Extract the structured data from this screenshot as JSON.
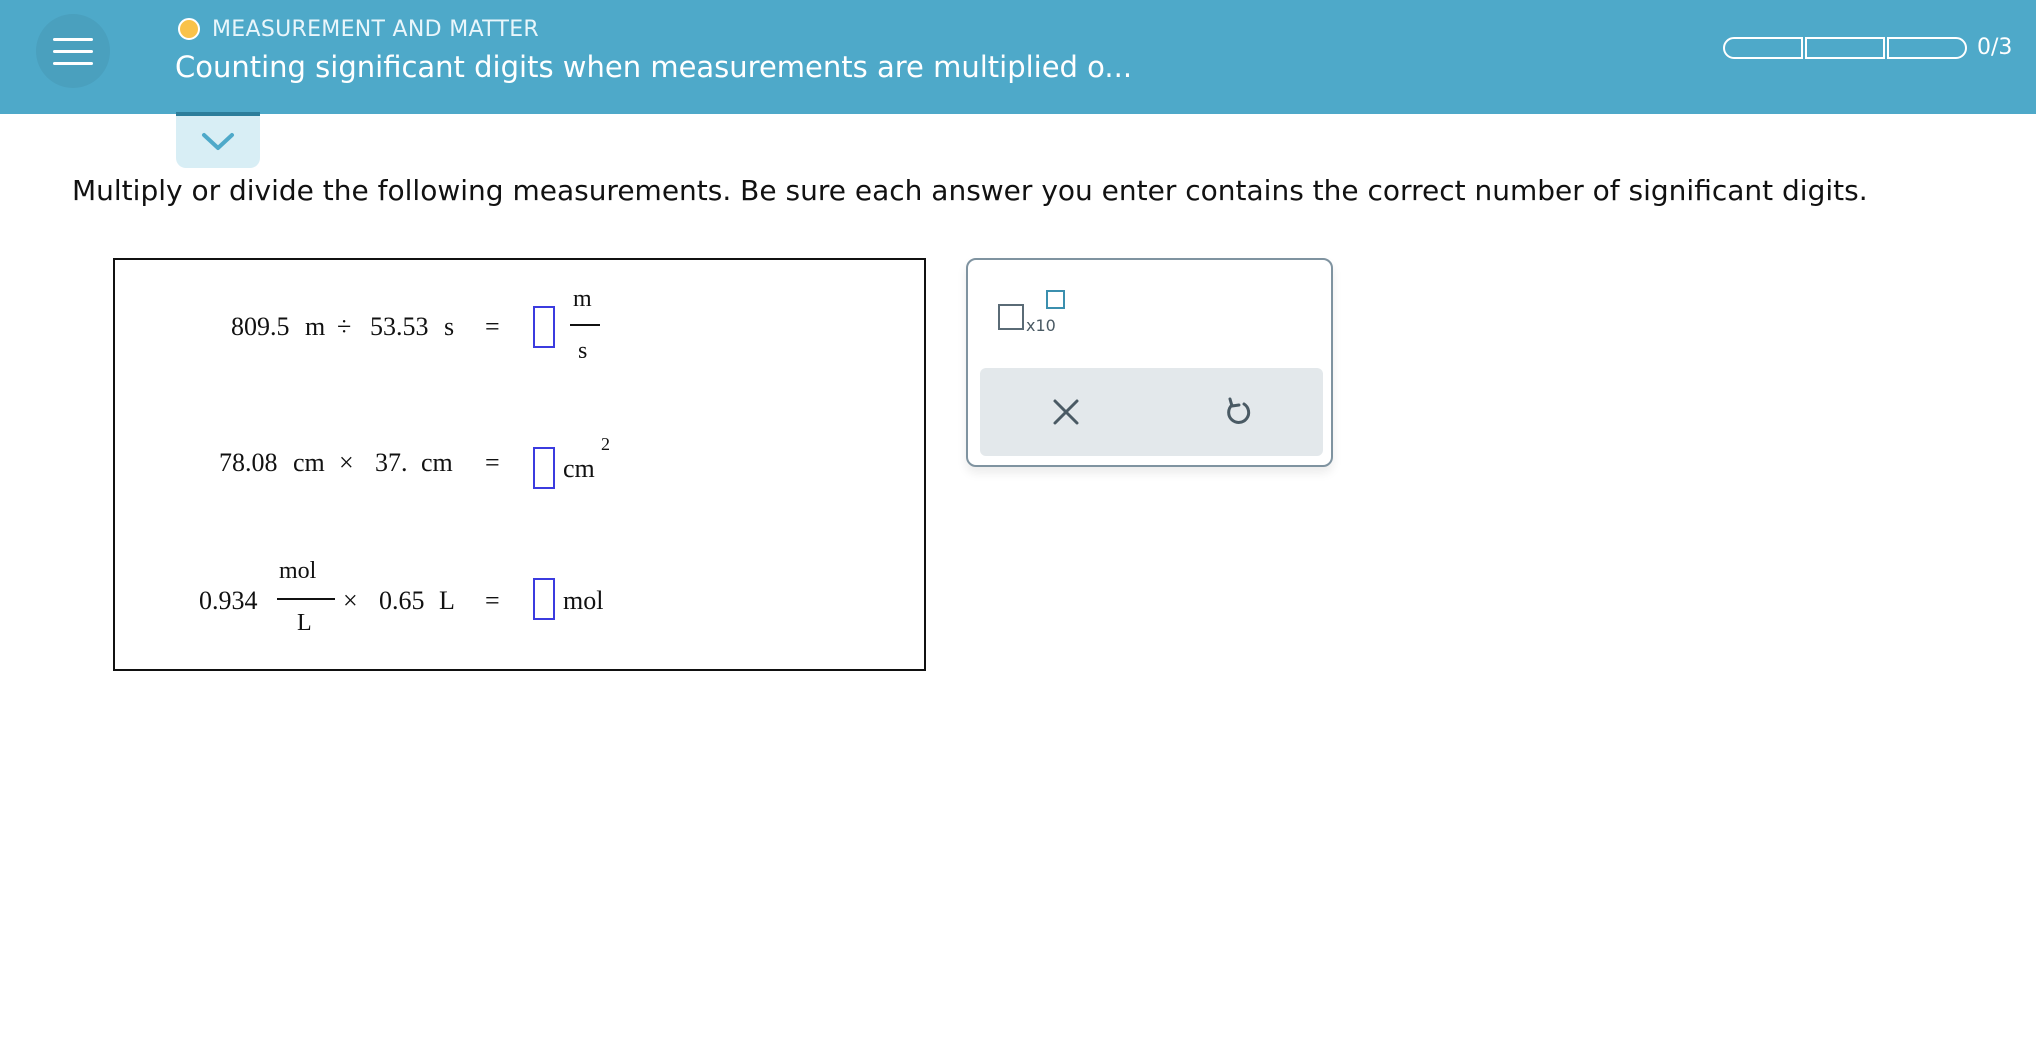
{
  "header": {
    "topic": "MEASUREMENT AND MATTER",
    "title": "Counting significant digits when measurements are multiplied o...",
    "progress_count": "0/3",
    "progress_fraction": 0,
    "colors": {
      "bar": "#4ea9c9",
      "status_dot": "#f9c24a"
    }
  },
  "instructions": "Multiply or divide the following measurements. Be sure each answer you enter contains the correct number of significant digits.",
  "problems": {
    "p1": {
      "value1": "809.5",
      "unit1": "m",
      "operator": "÷",
      "value2": "53.53",
      "unit2": "s",
      "equals": "=",
      "answer_unit_num": "m",
      "answer_unit_den": "s"
    },
    "p2": {
      "value1": "78.08",
      "unit1": "cm",
      "operator": "×",
      "value2": "37.",
      "unit2": "cm",
      "equals": "=",
      "answer_unit": "cm",
      "answer_exponent": "2"
    },
    "p3": {
      "value1": "0.934",
      "unit1_num": "mol",
      "unit1_den": "L",
      "operator": "×",
      "value2": "0.65",
      "unit2": "L",
      "equals": "=",
      "answer_unit": "mol"
    }
  },
  "tools": {
    "sci_notation_label": "x10",
    "icons": [
      "scientific-notation-icon",
      "clear-icon",
      "undo-icon"
    ]
  }
}
